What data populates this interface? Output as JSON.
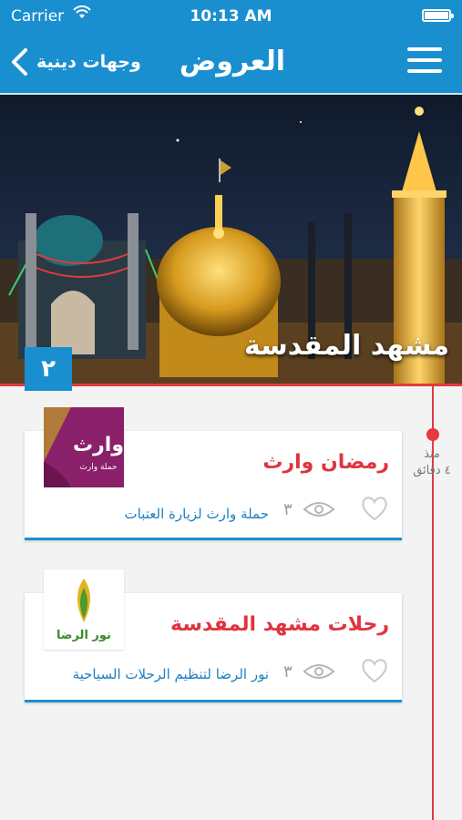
{
  "status_bar": {
    "carrier": "Carrier",
    "time": "10:13 AM"
  },
  "nav": {
    "back_label": "وجهات دينية",
    "title": "العروض"
  },
  "hero": {
    "title": "مشهد المقدسة",
    "count": "٢"
  },
  "timeline": {
    "line1": "منذ",
    "line2": "٤ دقائق"
  },
  "offers": [
    {
      "title": "رمضان وارث",
      "subtitle": "حملة وارث لزيارة العتبات",
      "views": "٣",
      "thumb_text": "وارث",
      "thumb_caption": "حملة وارث"
    },
    {
      "title": "رحلات مشهد المقدسة",
      "subtitle": "نور الرضا لتنظيم الرحلات السياحية",
      "views": "٣",
      "thumb_text": "نور الرضا"
    }
  ],
  "colors": {
    "brand_blue": "#1a8fd0",
    "accent_red": "#e0343d"
  }
}
